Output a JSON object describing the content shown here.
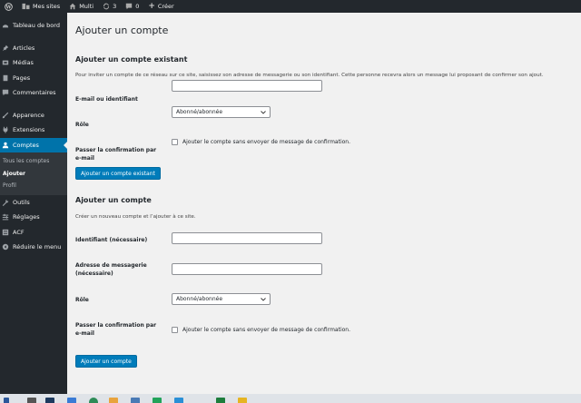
{
  "adminbar": {
    "my_sites": "Mes sites",
    "site_name": "Multi",
    "updates_count": "3",
    "comments_count": "0",
    "new_label": "Créer"
  },
  "sidebar": {
    "items": [
      {
        "label": "Tableau de bord",
        "icon": "dashboard-icon"
      },
      {
        "label": "Articles",
        "icon": "pin-icon"
      },
      {
        "label": "Médias",
        "icon": "media-icon"
      },
      {
        "label": "Pages",
        "icon": "page-icon"
      },
      {
        "label": "Commentaires",
        "icon": "comment-icon"
      },
      {
        "label": "Apparence",
        "icon": "brush-icon"
      },
      {
        "label": "Extensions",
        "icon": "plugin-icon"
      },
      {
        "label": "Comptes",
        "icon": "user-icon"
      },
      {
        "label": "Outils",
        "icon": "wrench-icon"
      },
      {
        "label": "Réglages",
        "icon": "settings-icon"
      },
      {
        "label": "ACF",
        "icon": "list-icon"
      },
      {
        "label": "Réduire le menu",
        "icon": "collapse-icon"
      }
    ],
    "submenu": [
      "Tous les comptes",
      "Ajouter",
      "Profil"
    ]
  },
  "page": {
    "title": "Ajouter un compte",
    "existing": {
      "heading": "Ajouter un compte existant",
      "description": "Pour inviter un compte de ce réseau sur ce site, saisissez son adresse de messagerie ou son identifiant. Cette personne recevra alors un message lui proposant de confirmer son ajout.",
      "email_label": "E-mail ou identifiant",
      "email_value": "",
      "role_label": "Rôle",
      "role_value": "Abonné/abonnée",
      "skip_label": "Passer la confirmation par e-mail",
      "skip_text": "Ajouter le compte sans envoyer de message de confirmation.",
      "submit": "Ajouter un compte existant"
    },
    "new": {
      "heading": "Ajouter un compte",
      "description": "Créer un nouveau compte et l’ajouter à ce site.",
      "username_label": "Identifiant (nécessaire)",
      "username_value": "",
      "email_label": "Adresse de messagerie (nécessaire)",
      "email_value": "",
      "role_label": "Rôle",
      "role_value": "Abonné/abonnée",
      "skip_label": "Passer la confirmation par e-mail",
      "skip_text": "Ajouter le compte sans envoyer de message de confirmation.",
      "submit": "Ajouter un compte"
    }
  },
  "colors": {
    "adminbar_bg": "#23282d",
    "accent": "#0073aa",
    "button": "#007cba",
    "background": "#f1f1f1"
  }
}
